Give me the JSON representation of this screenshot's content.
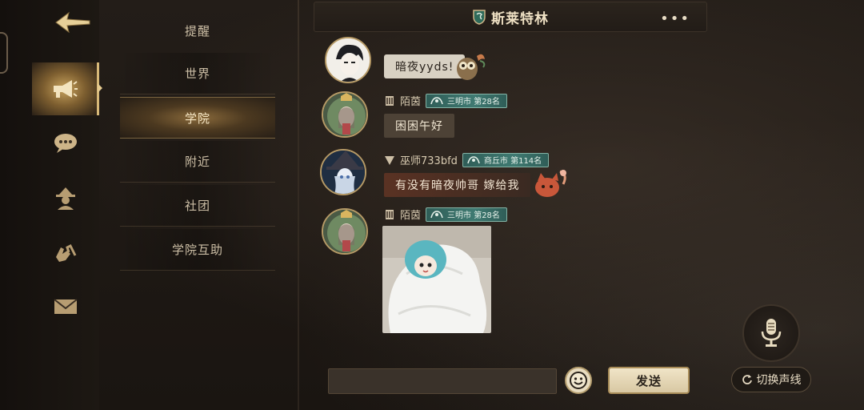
{
  "header": {
    "title": "斯莱特林",
    "more_label": "•••"
  },
  "nav": {
    "back_icon": "back-arrow-icon",
    "rail_icons": [
      "megaphone-icon",
      "chat-bubble-icon",
      "wizard-icon",
      "hands-icon",
      "envelope-icon"
    ],
    "active_rail_index": 0
  },
  "channels": {
    "items": [
      "提醒",
      "世界",
      "学院",
      "附近",
      "社团",
      "学院互助"
    ],
    "active": "学院"
  },
  "messages": [
    {
      "sender": "",
      "text": "暗夜yyds!",
      "style": "light"
    },
    {
      "sender": "陌茵",
      "rank": "三明市 第28名",
      "text": "困困午好",
      "style": "dark"
    },
    {
      "sender": "巫师733bfd",
      "rank": "商丘市 第114名",
      "text": "有没有暗夜帅哥 嫁给我",
      "style": "red"
    },
    {
      "sender": "陌茵",
      "rank": "三明市 第28名",
      "image": "photo-blanket"
    }
  ],
  "composer": {
    "input_placeholder": "",
    "send_label": "发送",
    "switch_voice_label": "切换声线"
  },
  "colors": {
    "accent_gold": "#c9a45f",
    "badge_teal": "#3f7a72",
    "bg_dark": "#1c1713"
  }
}
